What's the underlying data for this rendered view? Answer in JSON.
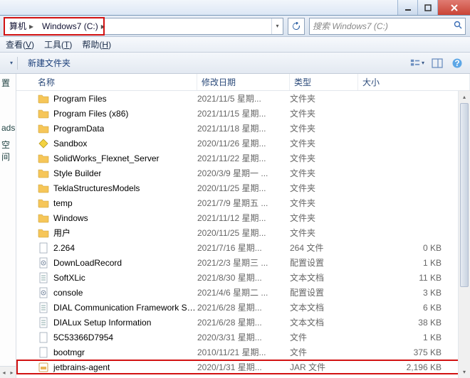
{
  "window": {
    "min": "min",
    "max": "max",
    "close": "close"
  },
  "address": {
    "crumbs": [
      "算机",
      "Windows7 (C:)"
    ],
    "search_placeholder": "搜索 Windows7 (C:)"
  },
  "menu": [
    {
      "label": "查看",
      "accel": "V"
    },
    {
      "label": "工具",
      "accel": "T"
    },
    {
      "label": "帮助",
      "accel": "H"
    }
  ],
  "toolbar": {
    "new_folder": "新建文件夹"
  },
  "columns": {
    "name": "名称",
    "date": "修改日期",
    "type": "类型",
    "size": "大小"
  },
  "left_fragments": [
    "置",
    "ads",
    "空间"
  ],
  "rows": [
    {
      "icon": "folder",
      "name": "Program Files",
      "date": "2021/11/5 星期...",
      "type": "文件夹",
      "size": ""
    },
    {
      "icon": "folder",
      "name": "Program Files (x86)",
      "date": "2021/11/15 星期...",
      "type": "文件夹",
      "size": ""
    },
    {
      "icon": "folder",
      "name": "ProgramData",
      "date": "2021/11/18 星期...",
      "type": "文件夹",
      "size": ""
    },
    {
      "icon": "diamond",
      "name": "Sandbox",
      "date": "2020/11/26 星期...",
      "type": "文件夹",
      "size": ""
    },
    {
      "icon": "folder",
      "name": "SolidWorks_Flexnet_Server",
      "date": "2021/11/22 星期...",
      "type": "文件夹",
      "size": ""
    },
    {
      "icon": "folder",
      "name": "Style Builder",
      "date": "2020/3/9 星期一 ...",
      "type": "文件夹",
      "size": ""
    },
    {
      "icon": "folder",
      "name": "TeklaStructuresModels",
      "date": "2020/11/25 星期...",
      "type": "文件夹",
      "size": ""
    },
    {
      "icon": "folder",
      "name": "temp",
      "date": "2021/7/9 星期五 ...",
      "type": "文件夹",
      "size": ""
    },
    {
      "icon": "folder",
      "name": "Windows",
      "date": "2021/11/12 星期...",
      "type": "文件夹",
      "size": ""
    },
    {
      "icon": "folder",
      "name": "用户",
      "date": "2020/11/25 星期...",
      "type": "文件夹",
      "size": ""
    },
    {
      "icon": "file",
      "name": "2.264",
      "date": "2021/7/16 星期...",
      "type": "264 文件",
      "size": "0 KB"
    },
    {
      "icon": "ini",
      "name": "DownLoadRecord",
      "date": "2021/2/3 星期三 ...",
      "type": "配置设置",
      "size": "1 KB"
    },
    {
      "icon": "txt",
      "name": "SoftXLic",
      "date": "2021/8/30 星期...",
      "type": "文本文档",
      "size": "11 KB"
    },
    {
      "icon": "ini",
      "name": "console",
      "date": "2021/4/6 星期二 ...",
      "type": "配置设置",
      "size": "3 KB"
    },
    {
      "icon": "txt",
      "name": "DIAL Communication Framework Set...",
      "date": "2021/6/28 星期...",
      "type": "文本文档",
      "size": "6 KB"
    },
    {
      "icon": "txt",
      "name": "DIALux Setup Information",
      "date": "2021/6/28 星期...",
      "type": "文本文档",
      "size": "38 KB"
    },
    {
      "icon": "file",
      "name": "5C53366D7954",
      "date": "2020/3/31 星期...",
      "type": "文件",
      "size": "1 KB"
    },
    {
      "icon": "file",
      "name": "bootmgr",
      "date": "2010/11/21 星期...",
      "type": "文件",
      "size": "375 KB"
    },
    {
      "icon": "jar",
      "name": "jetbrains-agent",
      "date": "2020/1/31 星期...",
      "type": "JAR 文件",
      "size": "2,196 KB",
      "highlight": true
    }
  ]
}
